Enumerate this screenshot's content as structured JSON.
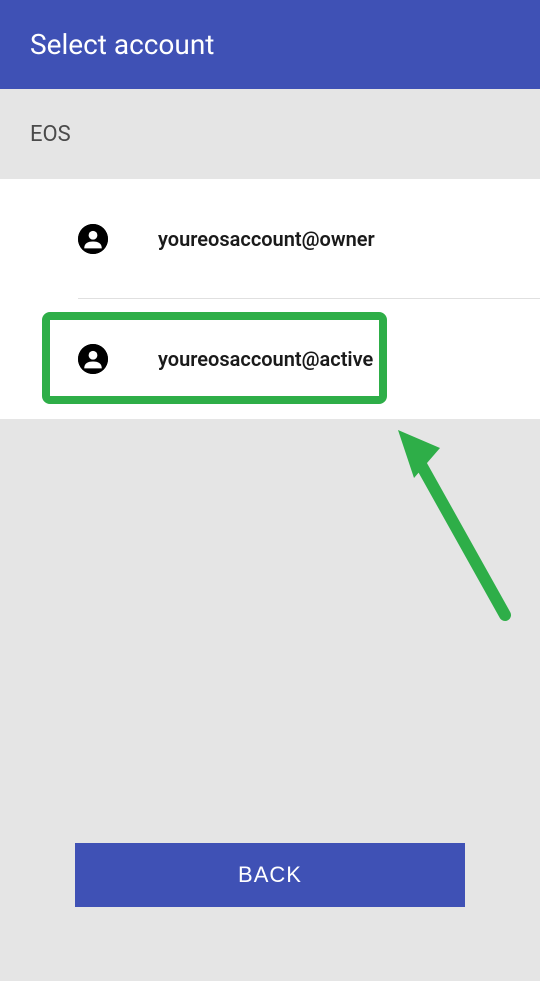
{
  "header": {
    "title": "Select account"
  },
  "section": {
    "title": "EOS"
  },
  "accounts": [
    {
      "label": "youreosaccount@owner"
    },
    {
      "label": "youreosaccount@active"
    }
  ],
  "buttons": {
    "back": "BACK"
  },
  "highlight": {
    "color": "#2eae48"
  }
}
